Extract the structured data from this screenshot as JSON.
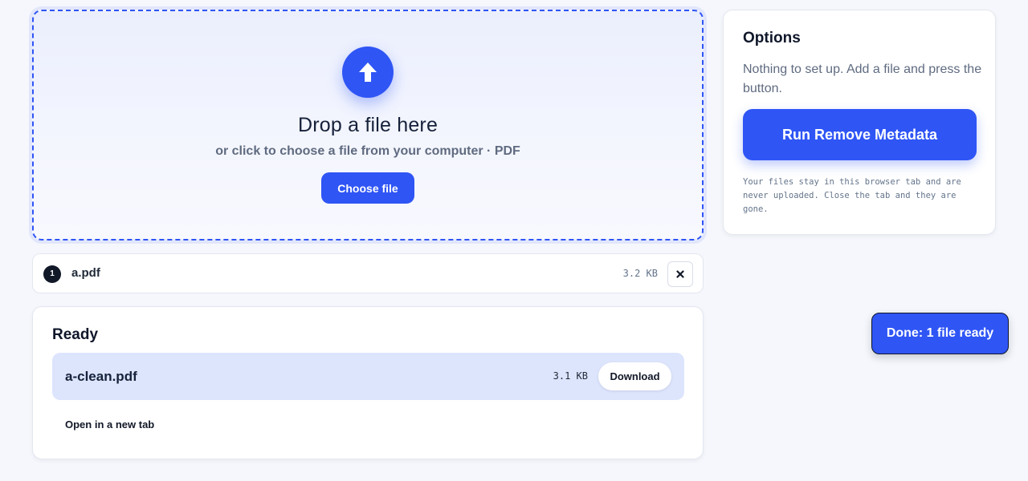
{
  "dropzone": {
    "icon": "upload-arrow-icon",
    "title": "Drop a file here",
    "subtitle": "or click to choose a file from your computer · PDF",
    "choose_label": "Choose file"
  },
  "file_list": [
    {
      "index": "1",
      "name": "a.pdf",
      "size": "3.2 KB",
      "remove_icon": "close-icon"
    }
  ],
  "results": {
    "title": "Ready",
    "items": [
      {
        "name": "a-clean.pdf",
        "size": "3.1 KB",
        "download_label": "Download"
      }
    ],
    "open_tab_label": "Open in a new tab"
  },
  "options": {
    "title": "Options",
    "description": "Nothing to set up. Add a file and press the button.",
    "run_label": "Run Remove Metadata",
    "privacy_note": "Your files stay in this browser tab and are never uploaded. Close the tab and they are gone."
  },
  "toast": {
    "message": "Done: 1 file ready"
  },
  "colors": {
    "accent": "#2f55f5",
    "background": "#f5f7fc",
    "result_row": "#dde5fd",
    "text_dark": "#0f172a",
    "text_muted": "#5f6b80"
  }
}
